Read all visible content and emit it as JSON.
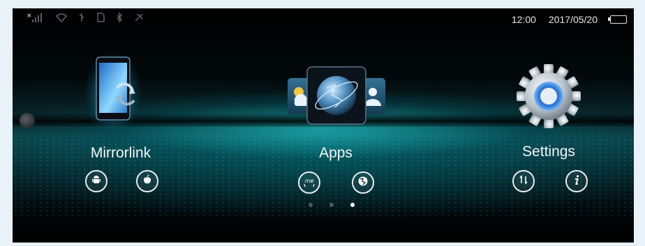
{
  "status_bar": {
    "time": "12:00",
    "date": "2017/05/20",
    "left_icons": [
      "signal-icon",
      "wifi-icon",
      "usb-icon",
      "sd-card-icon",
      "bluetooth-icon",
      "gps-icon"
    ],
    "battery_icon": "battery-icon"
  },
  "tiles": [
    {
      "label": "Mirrorlink",
      "icon": "mirrorlink-icon",
      "buttons": [
        "android-icon",
        "apple-icon"
      ]
    },
    {
      "label": "Apps",
      "icon": "apps-icon",
      "buttons": [
        "me-icon",
        "globe-icon"
      ]
    },
    {
      "label": "Settings",
      "icon": "gear-icon",
      "buttons": [
        "sort-icon",
        "info-icon"
      ]
    }
  ],
  "pagination": {
    "total": 3,
    "active_index": 2
  },
  "colors": {
    "accent": "#2fd6d6",
    "background": "#000000",
    "text": "#f4f6f6"
  }
}
